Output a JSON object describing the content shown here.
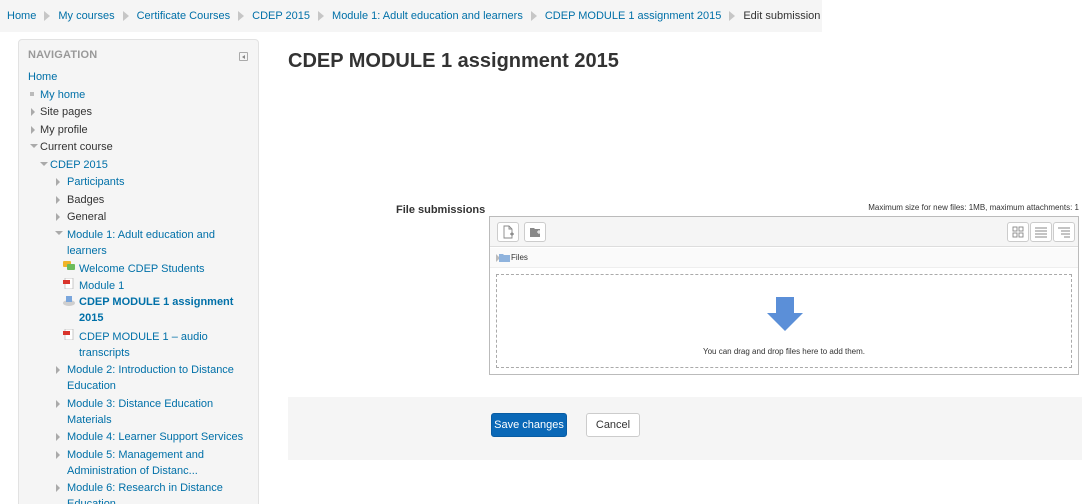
{
  "breadcrumb": {
    "items": [
      "Home",
      "My courses",
      "Certificate Courses",
      "CDEP 2015",
      "Module 1: Adult education and learners",
      "CDEP MODULE 1 assignment 2015",
      "Edit submission"
    ]
  },
  "navigation": {
    "header": "NAVIGATION",
    "home": "Home",
    "my_home": "My home",
    "site_pages": "Site pages",
    "my_profile": "My profile",
    "current_course": "Current course",
    "course": "CDEP 2015",
    "participants": "Participants",
    "badges": "Badges",
    "general": "General",
    "module1_line1": "Module 1: Adult education and",
    "module1_line2": "learners",
    "welcome": "Welcome CDEP Students",
    "module1_res": "Module 1",
    "assignment_line1": "CDEP MODULE 1 assignment",
    "assignment_line2": "2015",
    "audio_line1": "CDEP MODULE 1 – audio",
    "audio_line2": "transcripts",
    "module2_line1": "Module 2: Introduction to Distance",
    "module2_line2": "Education",
    "module3_line1": "Module 3: Distance Education",
    "module3_line2": "Materials",
    "module4": "Module 4: Learner Support Services",
    "module5_line1": "Module 5: Management and",
    "module5_line2": "Administration of Distanc...",
    "module6_line1": "Module 6: Research in Distance",
    "module6_line2": "Education"
  },
  "main": {
    "title": "CDEP MODULE 1 assignment 2015",
    "file_label": "File submissions",
    "max_size": "Maximum size for new files: 1MB, maximum attachments: 1",
    "path_label": "Files",
    "drop_text": "You can drag and drop files here to add them.",
    "save_label": "Save changes",
    "cancel_label": "Cancel"
  },
  "colors": {
    "link": "#0070a8",
    "primary_button": "#0a68b7",
    "panel": "#f5f5f5",
    "drop_arrow": "#5b8fd8"
  }
}
